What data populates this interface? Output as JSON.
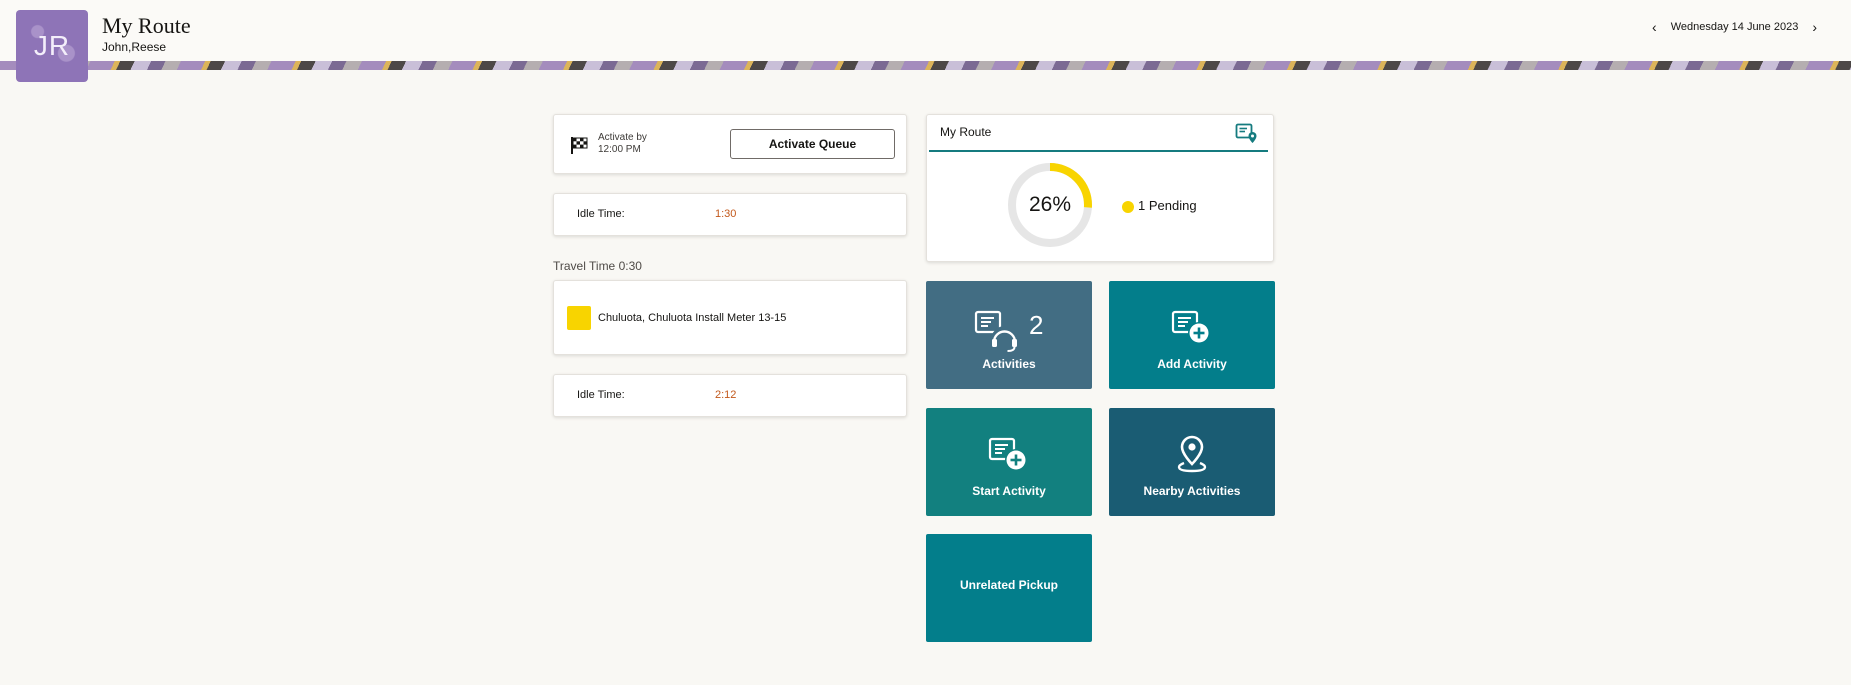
{
  "header": {
    "avatar_initials": "JR",
    "title": "My Route",
    "user_name": "John,Reese",
    "date": "Wednesday 14 June 2023"
  },
  "queue": {
    "activate_by_label": "Activate by",
    "activate_by_time": "12:00 PM",
    "button_label": "Activate Queue"
  },
  "idle_1": {
    "label": "Idle Time:",
    "value": "1:30"
  },
  "travel_time": "Travel Time 0:30",
  "activity": {
    "text": "Chuluota, Chuluota Install Meter 13-15",
    "status_color": "#f8d400"
  },
  "idle_2": {
    "label": "Idle Time:",
    "value": "2:12"
  },
  "route": {
    "title": "My Route",
    "percent_label": "26%",
    "percent_value": 26,
    "pending_label": "1 Pending",
    "progress_color": "#f8d400",
    "track_color": "#e6e6e6"
  },
  "tiles": {
    "activities": {
      "label": "Activities",
      "count": "2",
      "color": "#426d83",
      "icon": "activities-headset-icon"
    },
    "add_activity": {
      "label": "Add Activity",
      "color": "#037e8b",
      "icon": "add-activity-icon"
    },
    "start_activity": {
      "label": "Start Activity",
      "color": "#12807f",
      "icon": "start-activity-icon"
    },
    "nearby_activities": {
      "label": "Nearby Activities",
      "color": "#1a5c73",
      "icon": "location-pin-icon"
    },
    "unrelated_pickup": {
      "label": "Unrelated Pickup",
      "color": "#037e8b"
    }
  },
  "colors": {
    "accent": "#157b7f",
    "idle_value": "#c2581b",
    "background": "#f9f8f4"
  }
}
